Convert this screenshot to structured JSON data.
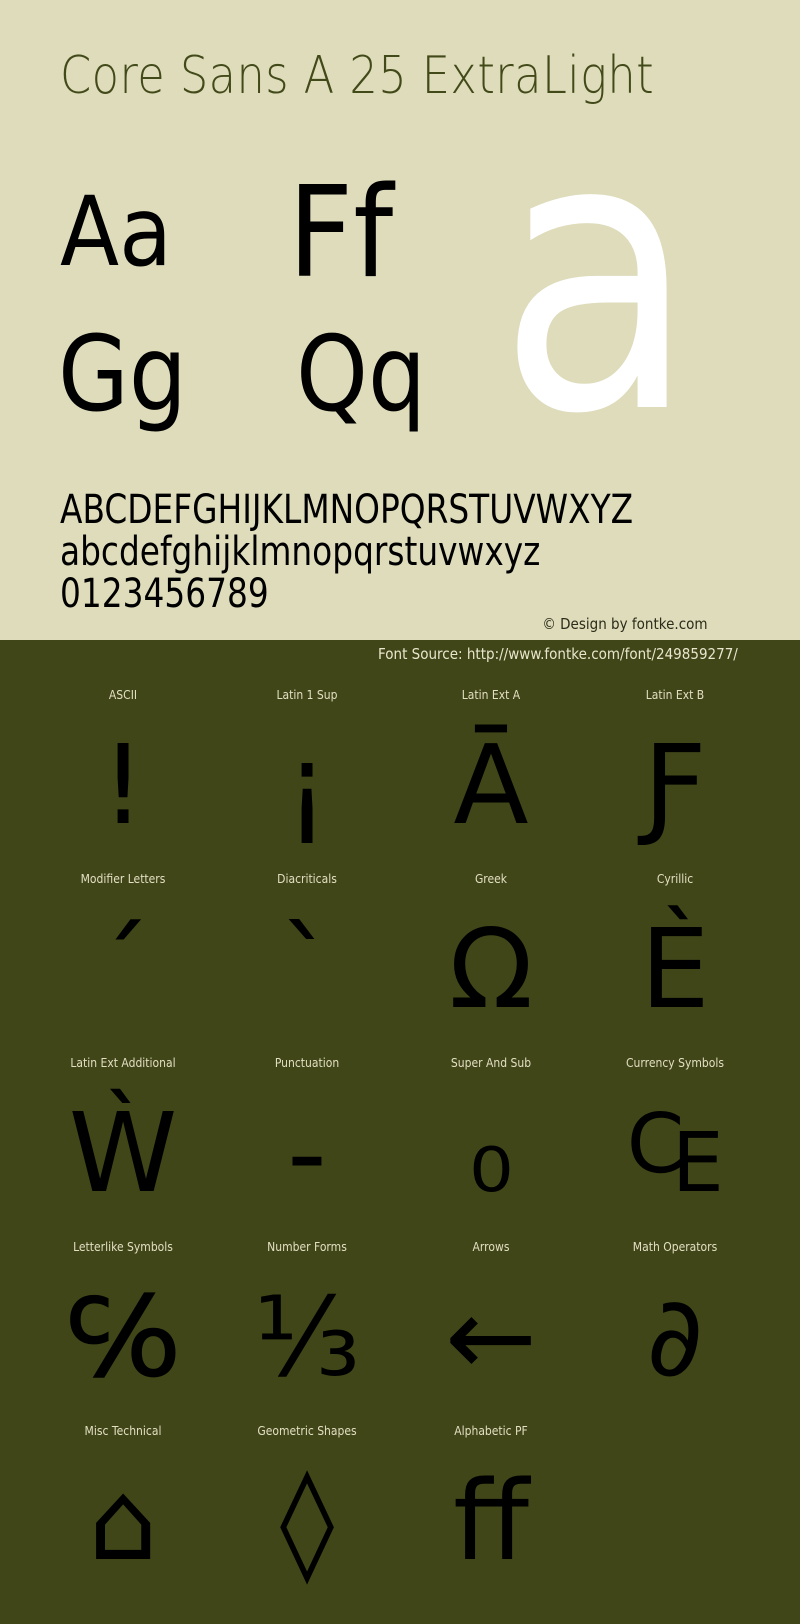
{
  "header": {
    "title": "Core Sans A 25 ExtraLight"
  },
  "specimen": {
    "pairs": [
      "Aa",
      "Ff",
      "Gg",
      "Qq"
    ],
    "large_glyph": "a",
    "uppercase": "ABCDEFGHIJKLMNOPQRSTUVWXYZ",
    "lowercase": "abcdefghijklmnopqrstuvwxyz",
    "digits": "0123456789"
  },
  "credit": "© Design by fontke.com",
  "source": "Font Source: http://www.fontke.com/font/249859277/",
  "colors": {
    "top_background": "#dedcbb",
    "bottom_background": "#404618",
    "title_color": "#434a19",
    "label_color": "#e2dfc2",
    "large_glyph_color": "#ffffff"
  },
  "blocks": [
    {
      "label": "ASCII",
      "glyph": "!"
    },
    {
      "label": "Latin 1 Sup",
      "glyph": "¡"
    },
    {
      "label": "Latin Ext A",
      "glyph": "Ā"
    },
    {
      "label": "Latin Ext B",
      "glyph": "Ƒ"
    },
    {
      "label": "Modifier Letters",
      "glyph": "ˊ"
    },
    {
      "label": "Diacriticals",
      "glyph": "ˋ"
    },
    {
      "label": "Greek",
      "glyph": "Ω"
    },
    {
      "label": "Cyrillic",
      "glyph": "Ѐ"
    },
    {
      "label": "Latin Ext Additional",
      "glyph": "Ẁ"
    },
    {
      "label": "Punctuation",
      "glyph": "‐"
    },
    {
      "label": "Super And Sub",
      "glyph": "₀"
    },
    {
      "label": "Currency Symbols",
      "glyph": "₠"
    },
    {
      "label": "Letterlike Symbols",
      "glyph": "℅"
    },
    {
      "label": "Number Forms",
      "glyph": "⅓"
    },
    {
      "label": "Arrows",
      "glyph": "←"
    },
    {
      "label": "Math Operators",
      "glyph": "∂"
    },
    {
      "label": "Misc Technical",
      "glyph": "⌂"
    },
    {
      "label": "Geometric Shapes",
      "glyph": "◊"
    },
    {
      "label": "Alphabetic PF",
      "glyph": "ﬀ"
    }
  ]
}
